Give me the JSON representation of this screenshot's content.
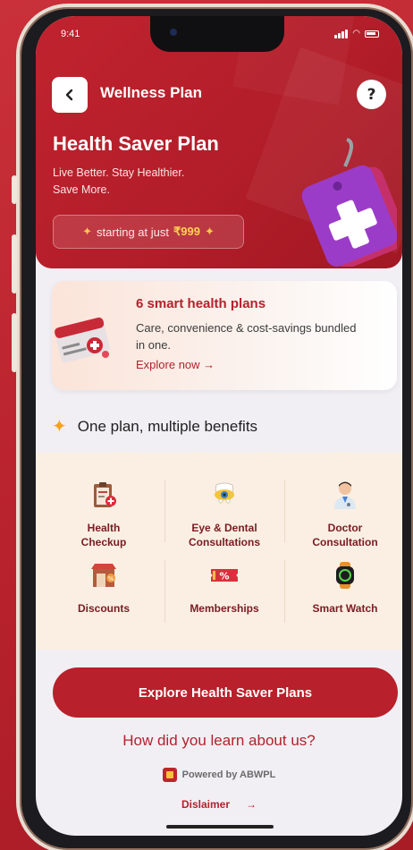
{
  "status_bar": {
    "time": "9:41"
  },
  "nav": {
    "back_icon": "chevron-left-icon",
    "title": "Wellness Plan",
    "help_label": "?"
  },
  "hero": {
    "title": "Health Saver Plan",
    "subtitle_line1": "Live Better. Stay Healthier.",
    "subtitle_line2": "Save More.",
    "price_prefix": "starting at just",
    "price_amount": "₹999",
    "sparkle": "✦"
  },
  "promo_card": {
    "title": "6 smart health plans",
    "description": "Care, convenience & cost-savings bundled in one.",
    "link_label": "Explore now",
    "link_arrow": "→"
  },
  "benefits_section": {
    "title": "One plan, multiple benefits",
    "star": "✦",
    "items": [
      {
        "line1": "Health",
        "line2": "Checkup",
        "icon": "clipboard-icon"
      },
      {
        "line1": "Eye & Dental",
        "line2": "Consultations",
        "icon": "eye-tooth-icon"
      },
      {
        "line1": "Doctor",
        "line2": "Consultation",
        "icon": "doctor-icon"
      },
      {
        "line1": "Discounts",
        "line2": "",
        "icon": "store-icon"
      },
      {
        "line1": "Memberships",
        "line2": "",
        "icon": "percent-ticket-icon"
      },
      {
        "line1": "Smart Watch",
        "line2": "",
        "icon": "smartwatch-icon"
      }
    ]
  },
  "cta": {
    "label": "Explore Health Saver Plans"
  },
  "footer": {
    "learn_label": "How did you learn about us?",
    "powered_label": "Powered by ABWPL",
    "disclaimer_label": "Dislaimer",
    "disclaimer_arrow": "→"
  },
  "colors": {
    "brand_red": "#b8202b",
    "accent_gold": "#ffd34e",
    "background": "#f1eff4"
  }
}
